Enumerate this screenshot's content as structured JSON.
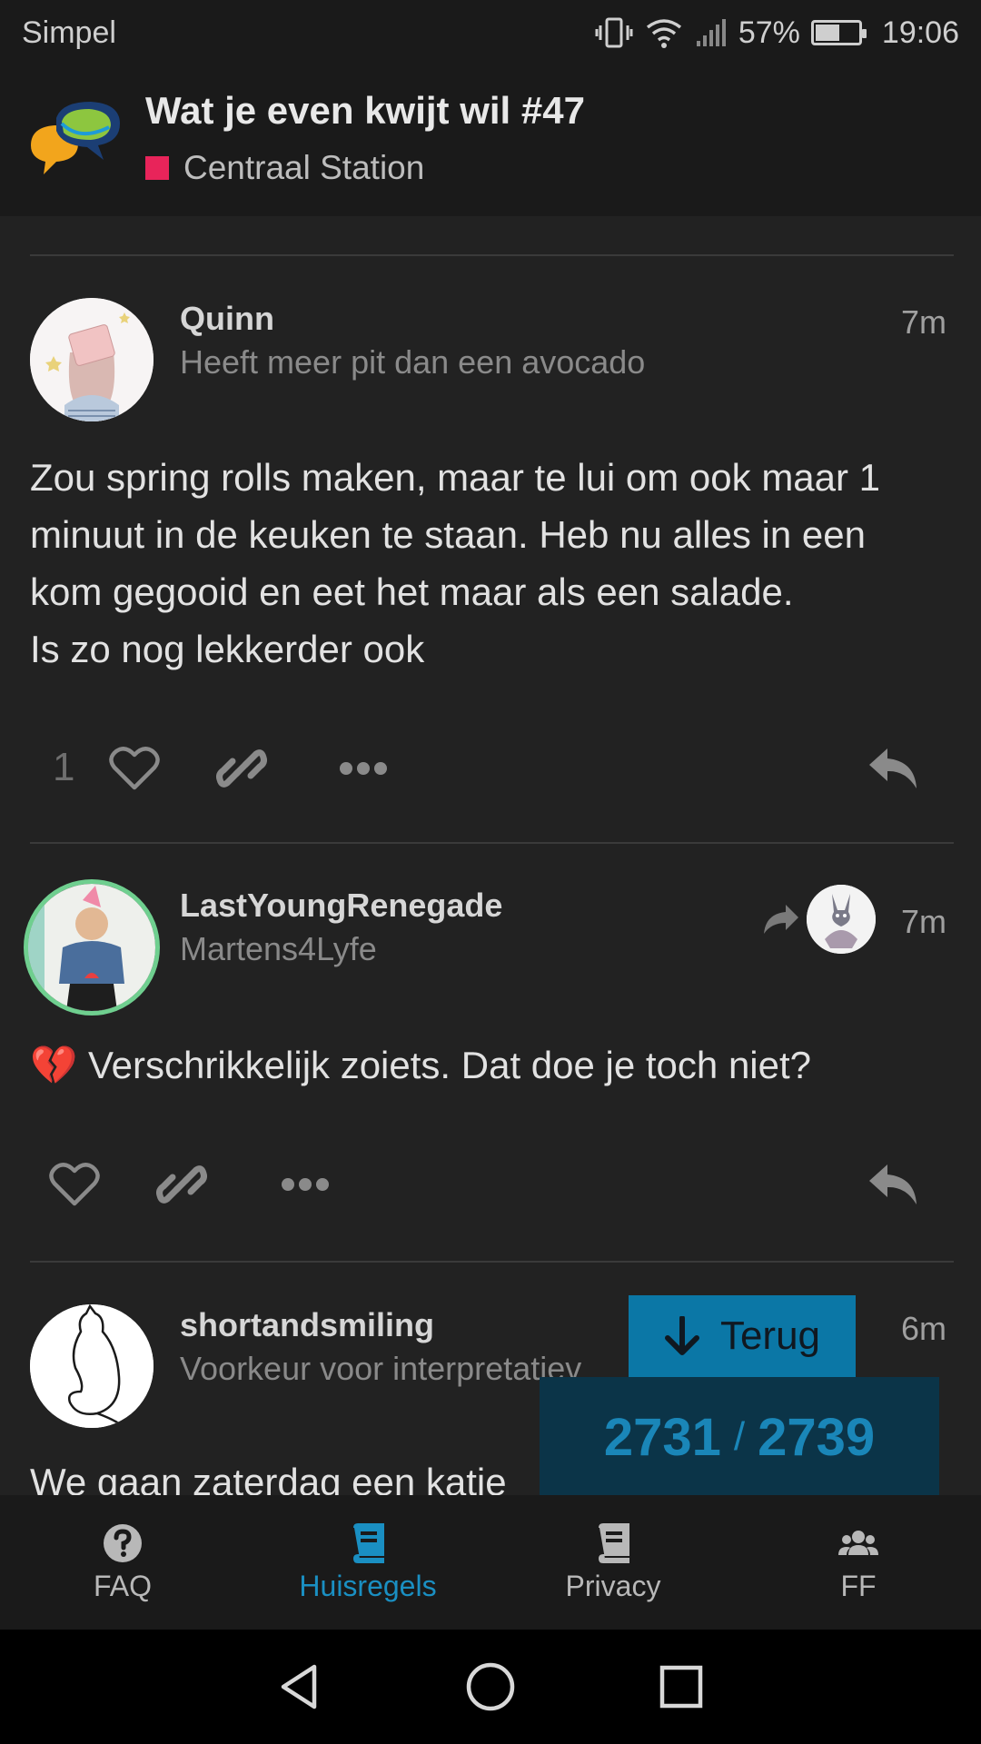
{
  "status_bar": {
    "carrier": "Simpel",
    "battery": "57%",
    "battery_level": 0.57,
    "time": "19:06"
  },
  "header": {
    "topic_title": "Wat je even kwijt wil #47",
    "category": "Centraal Station",
    "category_color": "#e8245a"
  },
  "posts": [
    {
      "username": "Quinn",
      "user_title": "Heeft meer pit dan een avocado",
      "age": "7m",
      "body": "Zou spring rolls maken, maar te lui om ook maar 1 minuut in de keuken te staan. Heb nu alles in een kom gegooid en eet het maar als een salade.\nIs zo nog lekkerder ook",
      "like_count": "1"
    },
    {
      "username": "LastYoungRenegade",
      "user_title": "Martens4Lyfe",
      "age": "7m",
      "body": "💔 Verschrikkelijk zoiets. Dat doe je toch niet?"
    },
    {
      "username": "shortandsmiling",
      "user_title": "Voorkeur voor interpretatiev",
      "age": "6m",
      "body": "We gaan zaterdag een katje"
    }
  ],
  "progress": {
    "back_label": "Terug",
    "current": "2731",
    "separator": "/",
    "total": "2739"
  },
  "bottom_nav": {
    "items": [
      {
        "label": "FAQ",
        "icon": "question-circle-icon"
      },
      {
        "label": "Huisregels",
        "icon": "book-icon",
        "active": true
      },
      {
        "label": "Privacy",
        "icon": "book-icon"
      },
      {
        "label": "FF",
        "icon": "users-icon"
      }
    ]
  },
  "colors": {
    "accent": "#1a8fc2",
    "background": "#222222",
    "header_bg": "#1a1a1a",
    "online_ring": "#6fcf8f"
  }
}
